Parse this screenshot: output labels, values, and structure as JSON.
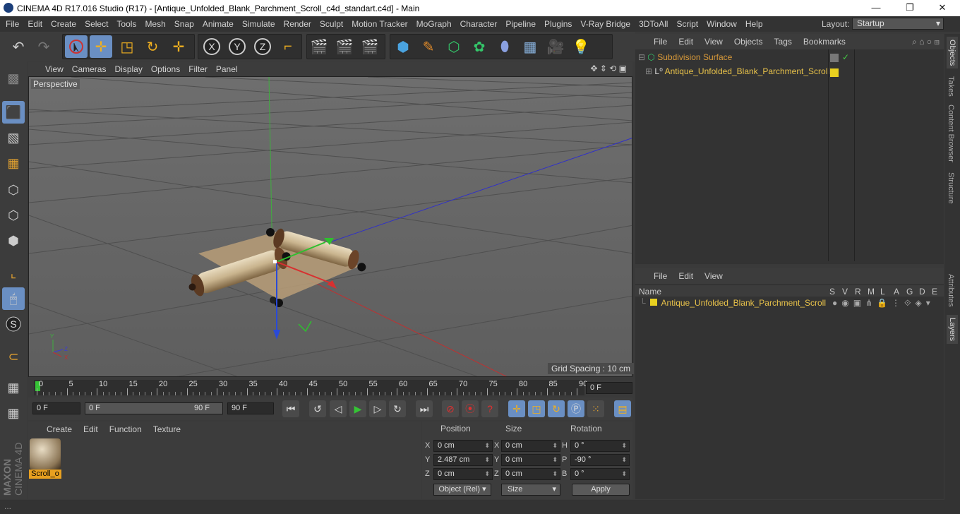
{
  "window": {
    "title": "CINEMA 4D R17.016 Studio (R17) - [Antique_Unfolded_Blank_Parchment_Scroll_c4d_standart.c4d] - Main",
    "minimize": "—",
    "maximize": "❐",
    "close": "✕"
  },
  "menu": [
    "File",
    "Edit",
    "Create",
    "Select",
    "Tools",
    "Mesh",
    "Snap",
    "Animate",
    "Simulate",
    "Render",
    "Sculpt",
    "Motion Tracker",
    "MoGraph",
    "Character",
    "Pipeline",
    "Plugins",
    "V-Ray Bridge",
    "3DToAll",
    "Script",
    "Window",
    "Help"
  ],
  "layout": {
    "label": "Layout:",
    "value": "Startup"
  },
  "viewport": {
    "menu": [
      "View",
      "Cameras",
      "Display",
      "Options",
      "Filter",
      "Panel"
    ],
    "camera": "Perspective",
    "grid_spacing": "Grid Spacing : 10 cm"
  },
  "timeline": {
    "ticks": [
      "0",
      "5",
      "10",
      "15",
      "20",
      "25",
      "30",
      "35",
      "40",
      "45",
      "50",
      "55",
      "60",
      "65",
      "70",
      "75",
      "80",
      "85",
      "90"
    ],
    "frame_field": "0 F"
  },
  "transport": {
    "start": "0 F",
    "range_start": "0 F",
    "range_end": "90 F",
    "end": "90 F"
  },
  "material": {
    "menu": [
      "Create",
      "Edit",
      "Function",
      "Texture"
    ],
    "name": "Scroll_o"
  },
  "coords": {
    "headers": [
      "Position",
      "Size",
      "Rotation"
    ],
    "rows": [
      {
        "axis": "X",
        "pos": "0 cm",
        "saxis": "X",
        "size": "0 cm",
        "raxis": "H",
        "rot": "0 °"
      },
      {
        "axis": "Y",
        "pos": "2.487 cm",
        "saxis": "Y",
        "size": "0 cm",
        "raxis": "P",
        "rot": "-90 °"
      },
      {
        "axis": "Z",
        "pos": "0 cm",
        "saxis": "Z",
        "size": "0 cm",
        "raxis": "B",
        "rot": "0 °"
      }
    ],
    "mode": "Object (Rel)",
    "size_mode": "Size",
    "apply": "Apply"
  },
  "objects": {
    "menu": [
      "File",
      "Edit",
      "View",
      "Objects",
      "Tags",
      "Bookmarks"
    ],
    "items": [
      "Subdivision Surface",
      "Antique_Unfolded_Blank_Parchment_Scroll"
    ]
  },
  "layers": {
    "menu": [
      "File",
      "Edit",
      "View"
    ],
    "columns": [
      "Name",
      "S",
      "V",
      "R",
      "M",
      "L",
      "A",
      "G",
      "D",
      "E"
    ],
    "item": "Antique_Unfolded_Blank_Parchment_Scroll"
  },
  "right_tabs": [
    "Objects",
    "Takes",
    "Content Browser",
    "Structure",
    "Attributes",
    "Layers"
  ],
  "brand": [
    "MAXON",
    "CINEMA 4D"
  ],
  "colors": {
    "accent": "#6a8fc3",
    "object_yellow": "#e8c24a",
    "subdiv_orange": "#d99a3a"
  }
}
